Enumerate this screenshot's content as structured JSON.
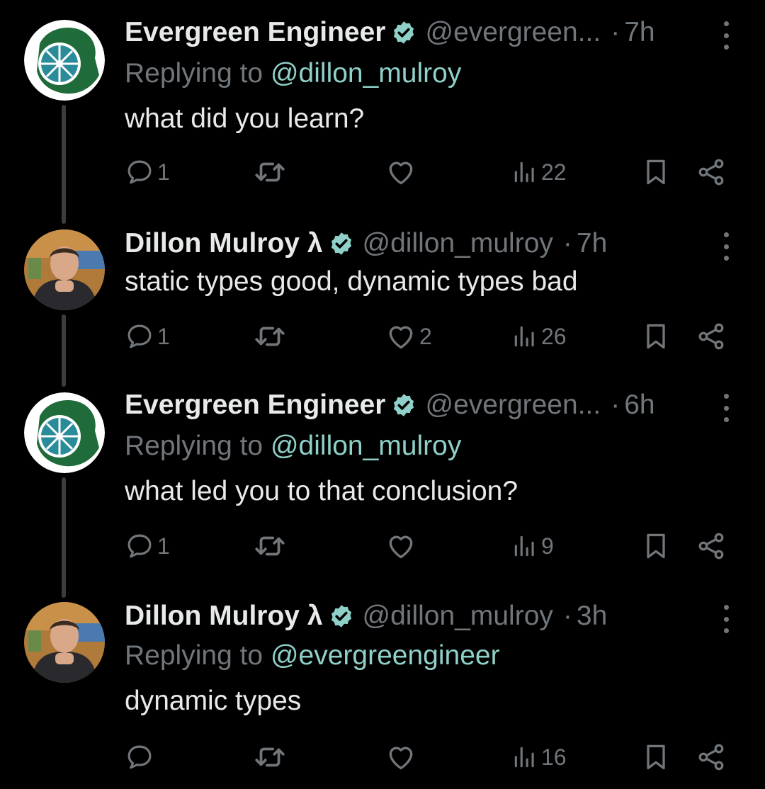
{
  "colors": {
    "background": "#000000",
    "text_primary": "#e7e9ea",
    "text_secondary": "#71767b",
    "mention": "#8fd1c9",
    "verified": "#8fd1c9"
  },
  "tweets": [
    {
      "author": "Evergreen Engineer",
      "handle": "@evergreen...",
      "separator": "·",
      "time": "7h",
      "avatar": "evergreen-lime-logo",
      "replying_prefix": "Replying to ",
      "replying_to": "@dillon_mulroy",
      "text": "what did you learn?",
      "replies": "1",
      "likes": "",
      "views": "22"
    },
    {
      "author": "Dillon Mulroy λ",
      "handle": "@dillon_mulroy",
      "separator": "·",
      "time": "7h",
      "avatar": "dillon-photo",
      "text": "static types good, dynamic types bad",
      "replies": "1",
      "likes": "2",
      "views": "26"
    },
    {
      "author": "Evergreen Engineer",
      "handle": "@evergreen...",
      "separator": "·",
      "time": "6h",
      "avatar": "evergreen-lime-logo",
      "replying_prefix": "Replying to ",
      "replying_to": "@dillon_mulroy",
      "text": "what led you to that conclusion?",
      "replies": "1",
      "likes": "",
      "views": "9"
    },
    {
      "author": "Dillon Mulroy λ",
      "handle": "@dillon_mulroy",
      "separator": "·",
      "time": "3h",
      "avatar": "dillon-photo",
      "replying_prefix": "Replying to ",
      "replying_to": "@evergreengineer",
      "text": "dynamic types",
      "replies": "",
      "likes": "",
      "views": "16"
    }
  ]
}
